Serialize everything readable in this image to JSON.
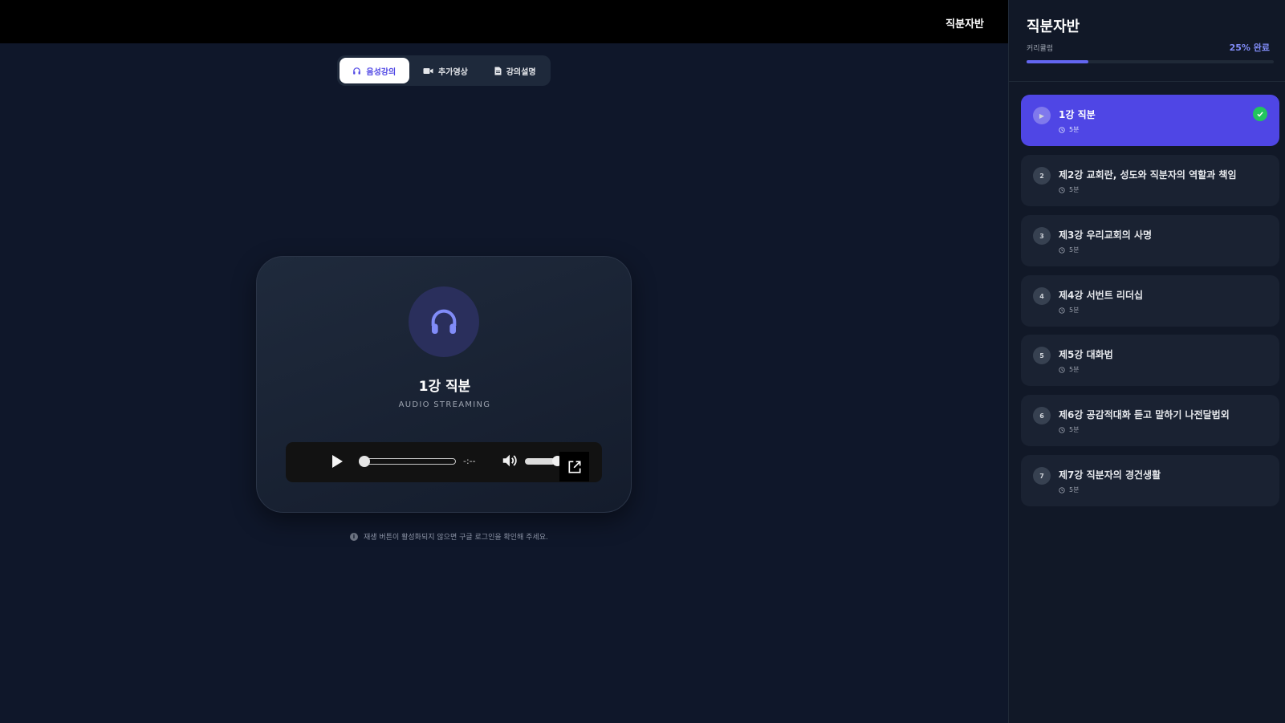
{
  "topbar": {
    "course_name": "직분자반"
  },
  "tabs": [
    {
      "label": "음성강의",
      "icon": "headphones-icon",
      "active": true
    },
    {
      "label": "추가영상",
      "icon": "video-camera-icon",
      "active": false
    },
    {
      "label": "강의설명",
      "icon": "document-icon",
      "active": false
    }
  ],
  "player": {
    "title": "1강 직분",
    "subtitle": "AUDIO STREAMING",
    "icon": "headphones-icon",
    "audio": {
      "time": "-:--",
      "progress": 0.0,
      "volume": 1.0
    }
  },
  "notice": {
    "text": "재생 버튼이 활성화되지 않으면 구글 로그인을 확인해 주세요."
  },
  "sidebar": {
    "title": "직분자반",
    "curriculum_label": "커리큘럼",
    "progress_text": "25% 완료",
    "progress": 0.25,
    "lessons": [
      {
        "num": "▶",
        "title": "1강 직분",
        "duration": "5분",
        "active": true,
        "completed": true
      },
      {
        "num": "2",
        "title": "제2강 교회란, 성도와 직분자의 역할과 책임",
        "duration": "5분",
        "active": false,
        "completed": false
      },
      {
        "num": "3",
        "title": "제3강 우리교회의 사명",
        "duration": "5분",
        "active": false,
        "completed": false
      },
      {
        "num": "4",
        "title": "제4강 서번트 리더십",
        "duration": "5분",
        "active": false,
        "completed": false
      },
      {
        "num": "5",
        "title": "제5강 대화법",
        "duration": "5분",
        "active": false,
        "completed": false
      },
      {
        "num": "6",
        "title": "제6강 공감적대화 듣고 말하기 나전달법외",
        "duration": "5분",
        "active": false,
        "completed": false
      },
      {
        "num": "7",
        "title": "제7강 직분자의 경건생활",
        "duration": "5분",
        "active": false,
        "completed": false
      }
    ]
  },
  "colors": {
    "accent": "#4f46e5",
    "accent_light": "#818cf8",
    "complete": "#22c55e",
    "background": "#0f172a"
  }
}
